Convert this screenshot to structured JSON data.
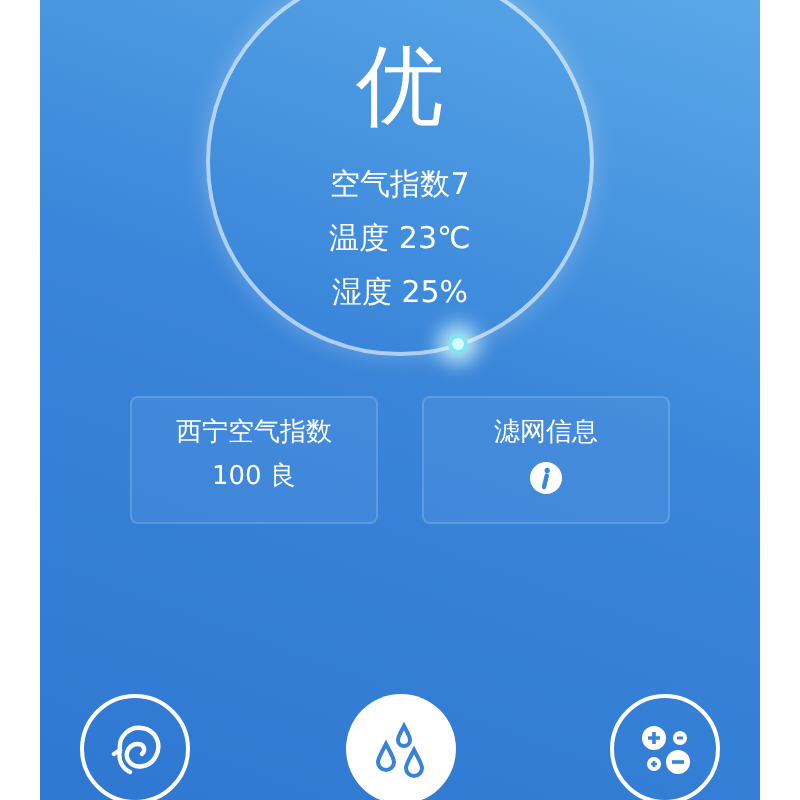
{
  "status": {
    "grade": "优",
    "lines": [
      "空气指数7",
      "温度 23℃",
      "湿度 25%"
    ]
  },
  "cards": [
    {
      "kind": "text",
      "title": "西宁空气指数",
      "value": "100 良"
    },
    {
      "kind": "info",
      "title": "滤网信息"
    }
  ],
  "modes": [
    {
      "kind": "swirl",
      "selected": false
    },
    {
      "kind": "drops",
      "selected": true
    },
    {
      "kind": "adjust",
      "selected": false
    }
  ]
}
